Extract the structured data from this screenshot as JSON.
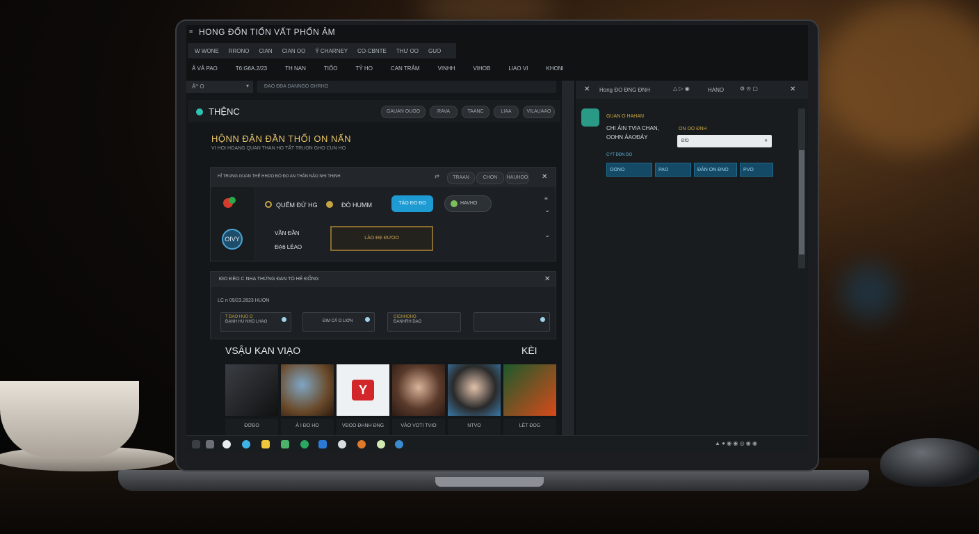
{
  "window": {
    "title": "HONG ĐỐN TIỐN VẤT PHỐN ẢM"
  },
  "menubar": [
    "W WONE",
    "RRONO",
    "CIAN",
    "CIAN OO",
    "Ý CHARNEY",
    "CO-CBNTE",
    "THƯ OO",
    "GUO"
  ],
  "tabbar": [
    "Ả VẢ PAO",
    "T6:G6A.2/23",
    "TH NAN",
    "TIỐO",
    "TỶ HO",
    "CAN TRẢM",
    "VINHH",
    "VIHOB",
    "LIAO VI",
    "KHONI"
  ],
  "address": {
    "left": "Ả^ O",
    "right": "ĐAO  ĐĐA  DANNGO  GHRHO"
  },
  "brand": {
    "name": "THỆNC",
    "pills": [
      "GAUAN OUOO",
      "RAVA",
      "TAANC",
      "LIAA",
      "VILAUAAO"
    ]
  },
  "hero": {
    "title": "HỘNN ĐẬN ĐẦN THỐI ON NẤN",
    "subtitle": "VI HOI HOANG QUAN THAN HO TẤT TRUON GHO CUN HO"
  },
  "card1": {
    "header": "HỈ TRUNG GUAN THẾ HHOO ĐÓ ĐO AN THÁN NẢO NHI THỊNH",
    "tabs": [
      "TRAAN",
      "CHON",
      "HAUHOO"
    ],
    "radio1": "QUẾM ĐỨ HG",
    "radio2": "ĐÒ HUMM",
    "blue_button": "TẢO ĐO ĐO",
    "dark_button": "HAVHO",
    "avatar_label": "OIVY",
    "field_label_1": "VẦN ĐẦN",
    "field_label_2": "ĐẠ6 LÉAO",
    "gold_input": "LẢO ĐẸ ĐƯOO"
  },
  "card2": {
    "header": "ĐIO   ĐÈO   C NHA THỨNG ĐAN TÓ HẺ ĐỐNG",
    "date": "LC  n  09/23.2823  HUON",
    "fields": [
      {
        "line1": "T ĐẠO HỤO O",
        "line2": "ĐẠNH HU NHO LHAO"
      },
      {
        "line1": "ĐIM CẢ O LIƠN",
        "line2": ""
      },
      {
        "line1": "CICHHOHO",
        "line2": "ĐANHRH DẠO"
      },
      {
        "line1": "",
        "line2": ""
      }
    ]
  },
  "gallery": {
    "title": "VSẬU KAN VIẠO",
    "more": "KÈI",
    "items": [
      "ĐƠĐO",
      "Ả I ĐO HO",
      "VĐOO ĐHNH ĐNG",
      "VẢO VOTI TVIO",
      "NTVO",
      "LẺT ĐOG"
    ]
  },
  "right_panel": {
    "header": "Hong ĐO ĐNG ĐNH",
    "header_right": "HANO",
    "item_title": "GUAN O HAHAN",
    "item_line1": "CHI ẢIN TVIA CHAN,",
    "item_line2": "OOHN ẢAOĐẢY",
    "field_label": "ON OO ĐNH",
    "field_value": "ĐÍO",
    "chips_label": "CYT ĐĐN ĐO",
    "chips": [
      "OONO",
      "PAO",
      "ĐẢN ON ĐNO",
      "PVO"
    ]
  },
  "colors": {
    "accent_blue": "#1f9bd3",
    "gold": "#e8c56a",
    "teal": "#2ec2b2",
    "chip": "#154a66"
  }
}
